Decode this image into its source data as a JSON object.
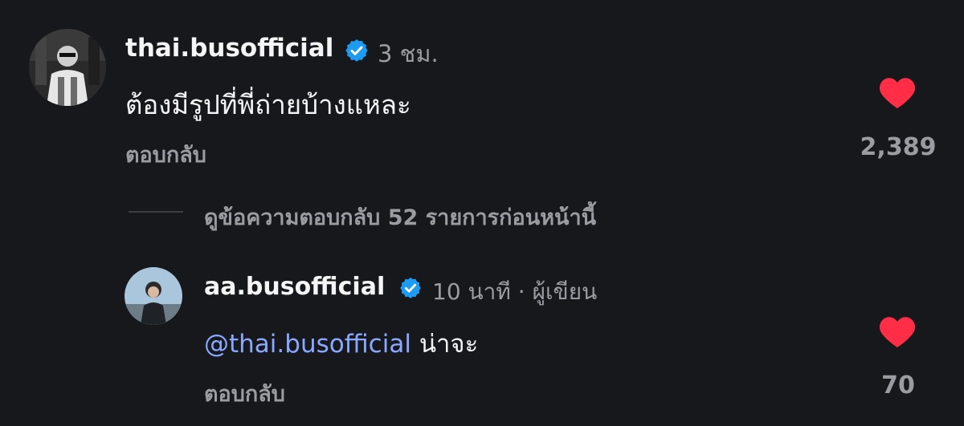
{
  "comment": {
    "username": "thai.busofficial",
    "time": "3 ชม.",
    "text": "ต้องมีรูปที่พี่ถ่ายบ้างแหละ",
    "reply_label": "ตอบกลับ",
    "likes": "2,389",
    "liked": true,
    "verified": true,
    "avatar_icon": "profile-photo"
  },
  "view_more_replies": {
    "label": "ดูข้อความตอบกลับ 52 รายการก่อนหน้านี้"
  },
  "reply": {
    "username": "aa.busofficial",
    "time": "10 นาที",
    "separator": "·",
    "author_tag": "ผู้เขียน",
    "mention": "@thai.busofficial",
    "text": "น่าจะ",
    "reply_label": "ตอบกลับ",
    "likes": "70",
    "liked": true,
    "verified": true,
    "avatar_icon": "profile-photo"
  },
  "colors": {
    "background": "#16181c",
    "verified": "#1d9bf0",
    "heart": "#ff2d46",
    "mention": "#8aa8ff",
    "muted": "#9a9ca1"
  }
}
